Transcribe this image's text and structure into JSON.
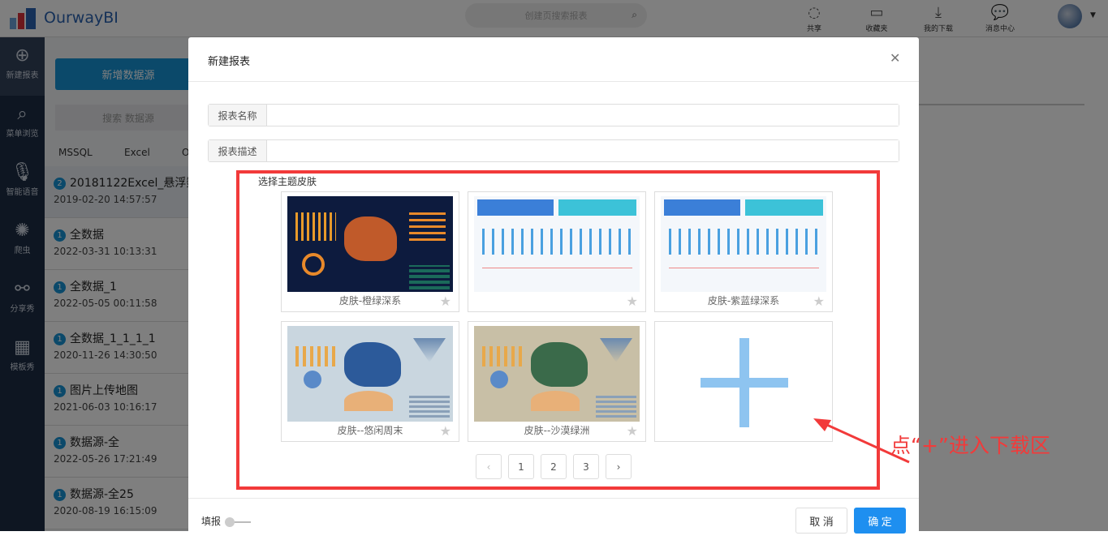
{
  "header": {
    "logo": "OurwayBI",
    "search_placeholder": "创建页搜索报表",
    "tools": [
      {
        "label": "共享",
        "icon": "share-icon"
      },
      {
        "label": "收藏夹",
        "icon": "folder-icon"
      },
      {
        "label": "我的下载",
        "icon": "download-icon"
      },
      {
        "label": "消息中心",
        "icon": "message-icon"
      }
    ]
  },
  "sidebar": {
    "items": [
      {
        "label": "新建报表",
        "icon": "plus-circle-icon"
      },
      {
        "label": "菜单浏览",
        "icon": "search-icon"
      },
      {
        "label": "智能语音",
        "icon": "microphone-icon"
      },
      {
        "label": "爬虫",
        "icon": "bug-icon"
      },
      {
        "label": "分享秀",
        "icon": "share-icon"
      },
      {
        "label": "模板秀",
        "icon": "grid-icon"
      }
    ]
  },
  "datasource": {
    "add_label": "新增数据源",
    "search_placeholder": "搜索 数据源",
    "tabs": [
      "MSSQL",
      "Excel",
      "O"
    ],
    "items": [
      {
        "badge": "2",
        "name": "20181122Excel_悬浮数",
        "date": "2019-02-20 14:57:57"
      },
      {
        "badge": "1",
        "name": "全数据",
        "date": "2022-03-31 10:13:31"
      },
      {
        "badge": "1",
        "name": "全数据_1",
        "date": "2022-05-05 00:11:58"
      },
      {
        "badge": "1",
        "name": "全数据_1_1_1_1",
        "date": "2020-11-26 14:30:50"
      },
      {
        "badge": "1",
        "name": "图片上传地图",
        "date": "2021-06-03 10:16:17"
      },
      {
        "badge": "1",
        "name": "数据源-全",
        "date": "2022-05-26 17:21:49"
      },
      {
        "badge": "1",
        "name": "数据源-全25",
        "date": "2020-08-19 16:15:09"
      }
    ]
  },
  "modal": {
    "title": "新建报表",
    "name_label": "报表名称",
    "name_value": "",
    "desc_label": "报表描述",
    "desc_value": "",
    "skin_label": "选择主题皮肤",
    "skins": [
      {
        "name": "皮肤-橙绿深系",
        "bg": "#0d1b3e"
      },
      {
        "name": "",
        "bg": "#f4f7fb"
      },
      {
        "name": "皮肤-紫蓝绿深系",
        "bg": "#f4f7fb"
      },
      {
        "name": "皮肤--悠闲周末",
        "bg": "#c9d6df"
      },
      {
        "name": "皮肤--沙漠绿洲",
        "bg": "#c8bfa6"
      }
    ],
    "add_skin_icon": "plus-icon",
    "pages": [
      "1",
      "2",
      "3"
    ],
    "fill_label": "填报",
    "cancel": "取 消",
    "ok": "确 定"
  },
  "annotation": "点“+”进入下载区",
  "colors": {
    "accent": "#1e8ff0",
    "annotation": "#f23a3a"
  }
}
